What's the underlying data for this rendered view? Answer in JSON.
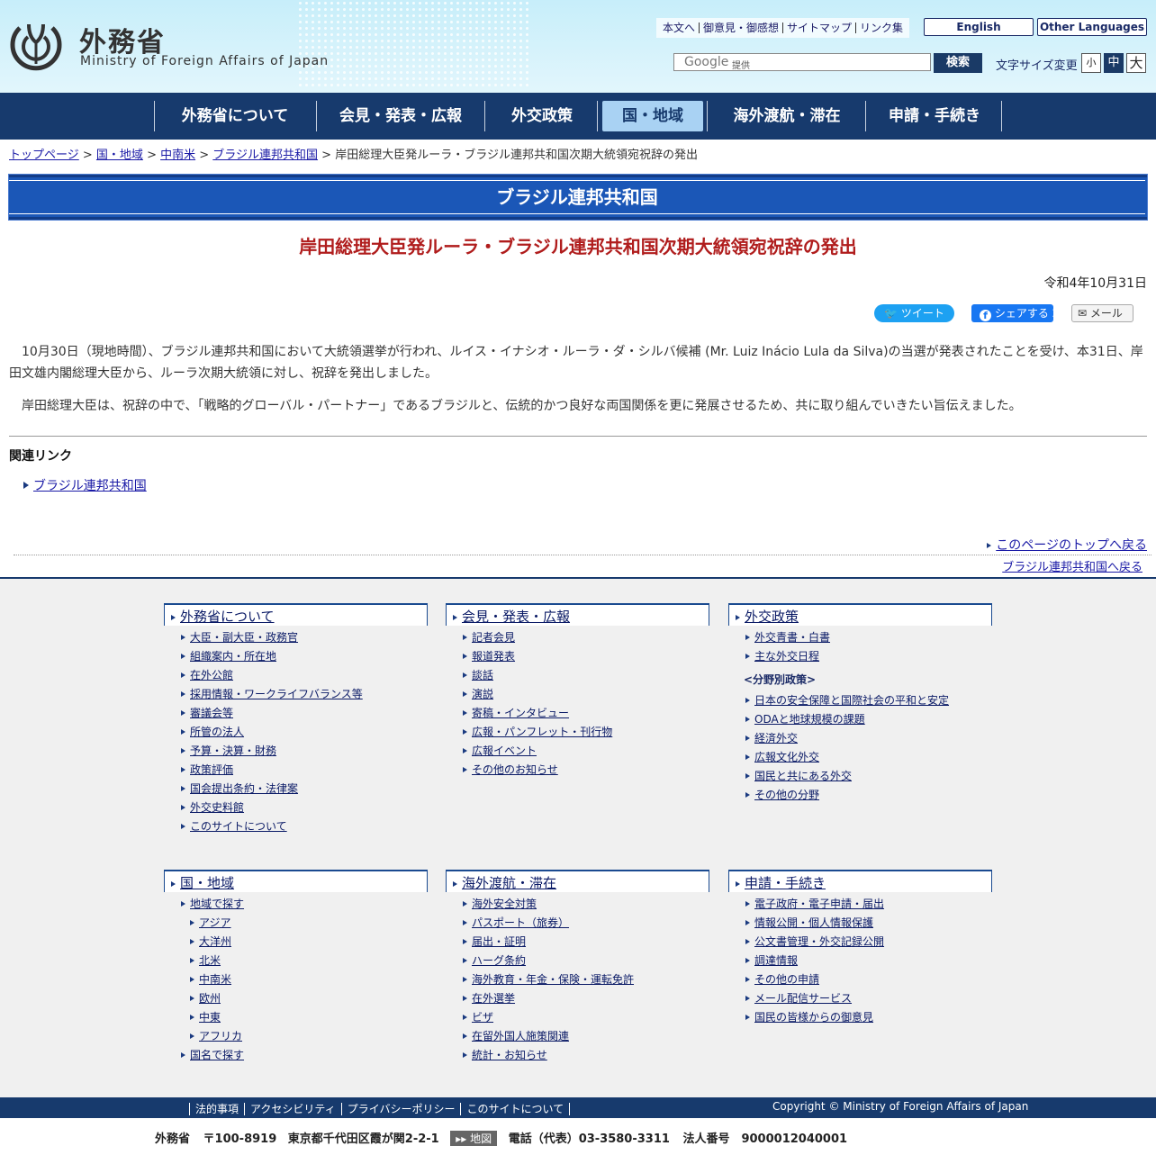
{
  "header": {
    "logo_jp": "外務省",
    "logo_en": "Ministry of Foreign Affairs of Japan",
    "top_links": [
      "本文へ",
      "御意見・御感想",
      "サイトマップ",
      "リンク集"
    ],
    "english_button": "English",
    "other_languages_button": "Other Languages",
    "search": {
      "google_label": "Google",
      "provider_label": "提供",
      "button": "検索"
    },
    "font_size": {
      "label": "文字サイズ変更",
      "small": "小",
      "medium": "中",
      "large": "大"
    }
  },
  "nav": {
    "items": [
      "外務省について",
      "会見・発表・広報",
      "外交政策",
      "国・地域",
      "海外渡航・滞在",
      "申請・手続き"
    ],
    "active": "国・地域"
  },
  "breadcrumb": {
    "links": [
      "トップページ",
      "国・地域",
      "中南米",
      "ブラジル連邦共和国"
    ],
    "current": "岸田総理大臣発ルーラ・ブラジル連邦共和国次期大統領宛祝辞の発出"
  },
  "page": {
    "section_title": "ブラジル連邦共和国",
    "heading": "岸田総理大臣発ルーラ・ブラジル連邦共和国次期大統領宛祝辞の発出",
    "date": "令和4年10月31日",
    "share": {
      "tweet": "ツイート",
      "facebook": "シェアする 2",
      "mail": "メール"
    },
    "paragraphs": [
      "10月30日（現地時間）、ブラジル連邦共和国において大統領選挙が行われ、ルイス・イナシオ・ルーラ・ダ・シルバ候補 (Mr. Luiz Inácio Lula da Silva)の当選が発表されたことを受け、本31日、岸田文雄内閣総理大臣から、ルーラ次期大統領に対し、祝辞を発出しました。",
      "岸田総理大臣は、祝辞の中で、「戦略的グローバル・パートナー」であるブラジルと、伝統的かつ良好な両国関係を更に発展させるため、共に取り組んでいきたい旨伝えました。"
    ],
    "related": {
      "title": "関連リンク",
      "link": "ブラジル連邦共和国"
    },
    "back_to_top": "このページのトップへ戻る",
    "back_to_country": "ブラジル連邦共和国へ戻る"
  },
  "footer": {
    "columns": [
      {
        "title": "外務省について",
        "items": [
          "大臣・副大臣・政務官",
          "組織案内・所在地",
          "在外公館",
          "採用情報・ワークライフバランス等",
          "審議会等",
          "所管の法人",
          "予算・決算・財務",
          "政策評価",
          "国会提出条約・法律案",
          "外交史料館",
          "このサイトについて"
        ]
      },
      {
        "title": "会見・発表・広報",
        "items": [
          "記者会見",
          "報道発表",
          "談話",
          "演説",
          "寄稿・インタビュー",
          "広報・パンフレット・刊行物",
          "広報イベント",
          "その他のお知らせ"
        ]
      },
      {
        "title": "外交政策",
        "items": [
          "外交青書・白書",
          "主な外交日程"
        ],
        "label": "<分野別政策>",
        "items2": [
          "日本の安全保障と国際社会の平和と安定",
          "ODAと地球規模の課題",
          "経済外交",
          "広報文化外交",
          "国民と共にある外交",
          "その他の分野"
        ]
      },
      {
        "title": "国・地域",
        "items": [
          "地域で探す"
        ],
        "sub_items": [
          "アジア",
          "大洋州",
          "北米",
          "中南米",
          "欧州",
          "中東",
          "アフリカ"
        ],
        "items_after": [
          "国名で探す"
        ]
      },
      {
        "title": "海外渡航・滞在",
        "items": [
          "海外安全対策",
          "パスポート（旅券）",
          "届出・証明",
          "ハーグ条約",
          "海外教育・年金・保険・運転免許",
          "在外選挙",
          "ビザ",
          "在留外国人施策関連",
          "統計・お知らせ"
        ]
      },
      {
        "title": "申請・手続き",
        "items": [
          "電子政府・電子申請・届出",
          "情報公開・個人情報保護",
          "公文書管理・外交記録公開",
          "調達情報",
          "その他の申請",
          "メール配信サービス",
          "国民の皆様からの御意見"
        ]
      }
    ],
    "bottom_links": [
      "法的事項",
      "アクセシビリティ",
      "プライバシーポリシー",
      "このサイトについて"
    ],
    "copyright": "Copyright © Ministry of Foreign Affairs of Japan",
    "address": {
      "org": "外務省",
      "postal": "〒100-8919",
      "street": "東京都千代田区霞が関2-2-1",
      "map_button": "地図",
      "phone": "電話（代表）03-3580-3311",
      "corp_number": "法人番号　9000012040001"
    }
  }
}
